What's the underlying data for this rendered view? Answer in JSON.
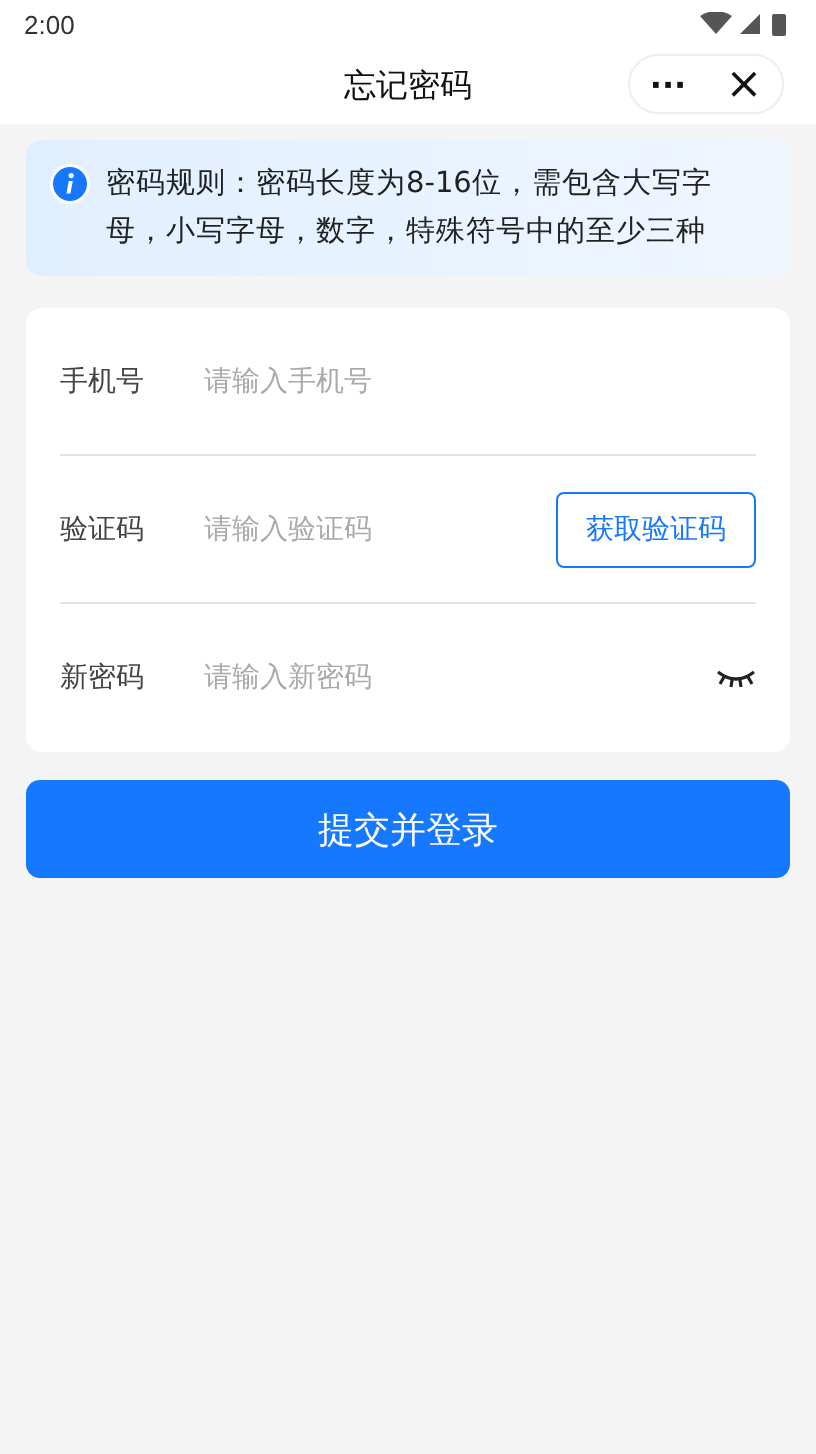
{
  "status_bar": {
    "time": "2:00"
  },
  "nav": {
    "title": "忘记密码",
    "more": "···",
    "close": "×"
  },
  "notice": {
    "text": "密码规则：密码长度为8-16位，需包含大写字母，小写字母，数字，特殊符号中的至少三种"
  },
  "fields": [
    {
      "kind": "text",
      "label": "手机号",
      "placeholder": "请输入手机号"
    },
    {
      "kind": "code",
      "label": "验证码",
      "placeholder": "请输入验证码",
      "button": "获取验证码"
    },
    {
      "kind": "password",
      "label": "新密码",
      "placeholder": "请输入新密码",
      "visible": false
    }
  ],
  "submit": "提交并登录"
}
